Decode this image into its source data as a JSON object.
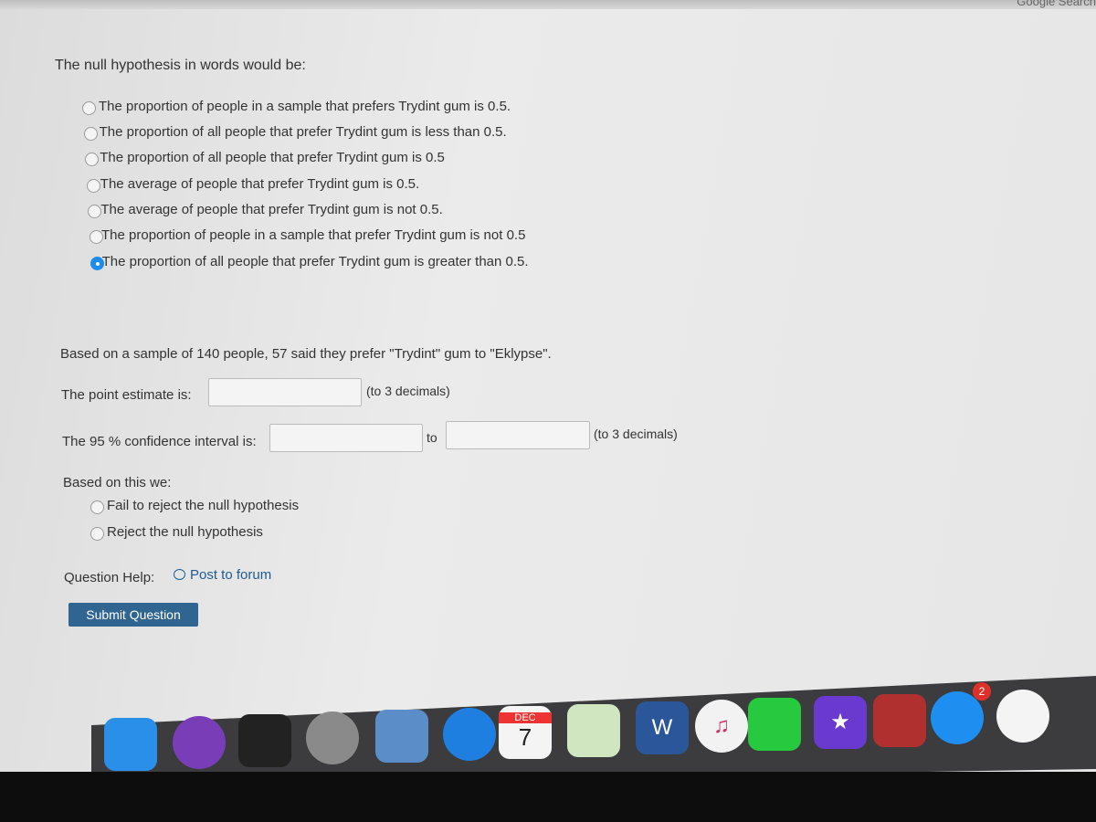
{
  "browser": {
    "top_right_text": "Google Search"
  },
  "question": {
    "title": "The null hypothesis in words would be:",
    "options": [
      {
        "label": "The proportion of people in a sample that prefers Trydint gum is 0.5.",
        "selected": false
      },
      {
        "label": "The proportion of all people that prefer Trydint gum is less than 0.5.",
        "selected": false
      },
      {
        "label": "The proportion of all people that prefer Trydint gum is 0.5",
        "selected": false
      },
      {
        "label": "The average of people that prefer Trydint gum is 0.5.",
        "selected": false
      },
      {
        "label": "The average of people that prefer Trydint gum is not 0.5.",
        "selected": false
      },
      {
        "label": "The proportion of people in a sample that prefer Trydint gum is not 0.5",
        "selected": false
      },
      {
        "label": "The proportion of all people that prefer Trydint gum is greater than 0.5.",
        "selected": true
      }
    ],
    "sample_text": "Based on a sample of 140 people, 57 said they prefer \"Trydint\" gum to \"Eklypse\".",
    "point_estimate_label": "The point estimate is:",
    "point_estimate_value": "",
    "decimals_note": "(to 3 decimals)",
    "ci_label": "The 95 % confidence interval is:",
    "ci_lower": "",
    "ci_to": "to",
    "ci_upper": "",
    "ci_decimals_note": "(to 3 decimals)",
    "conclusion_label": "Based on this we:",
    "conclusion_options": [
      {
        "label": "Fail to reject the null hypothesis",
        "selected": false
      },
      {
        "label": "Reject the null hypothesis",
        "selected": false
      }
    ],
    "help_label": "Question Help:",
    "post_forum": "Post to forum",
    "submit": "Submit Question"
  },
  "dock": {
    "items": [
      {
        "name": "finder",
        "color": "#2a8fe8"
      },
      {
        "name": "siri",
        "color": "#7a3db8"
      },
      {
        "name": "mission-control",
        "color": "#222"
      },
      {
        "name": "launchpad",
        "color": "#8a8a8a"
      },
      {
        "name": "mail",
        "color": "#5b8ec9"
      },
      {
        "name": "safari",
        "color": "#1f7fe0"
      },
      {
        "name": "calendar",
        "color": "#f4f4f4",
        "month": "DEC",
        "day": "7"
      },
      {
        "name": "maps",
        "color": "#cfe6c0"
      },
      {
        "name": "word",
        "color": "#2b579a",
        "letter": "W"
      },
      {
        "name": "itunes",
        "color": "#f2f2f2",
        "glyph": "♫"
      },
      {
        "name": "facetime",
        "color": "#27c93f"
      },
      {
        "name": "imovie",
        "color": "#6a3ad0",
        "glyph": "★"
      },
      {
        "name": "photo-booth",
        "color": "#b03030"
      },
      {
        "name": "app-store",
        "color": "#1f8ef1",
        "badge": "2"
      },
      {
        "name": "photos",
        "color": "#f4f4f4"
      }
    ]
  }
}
